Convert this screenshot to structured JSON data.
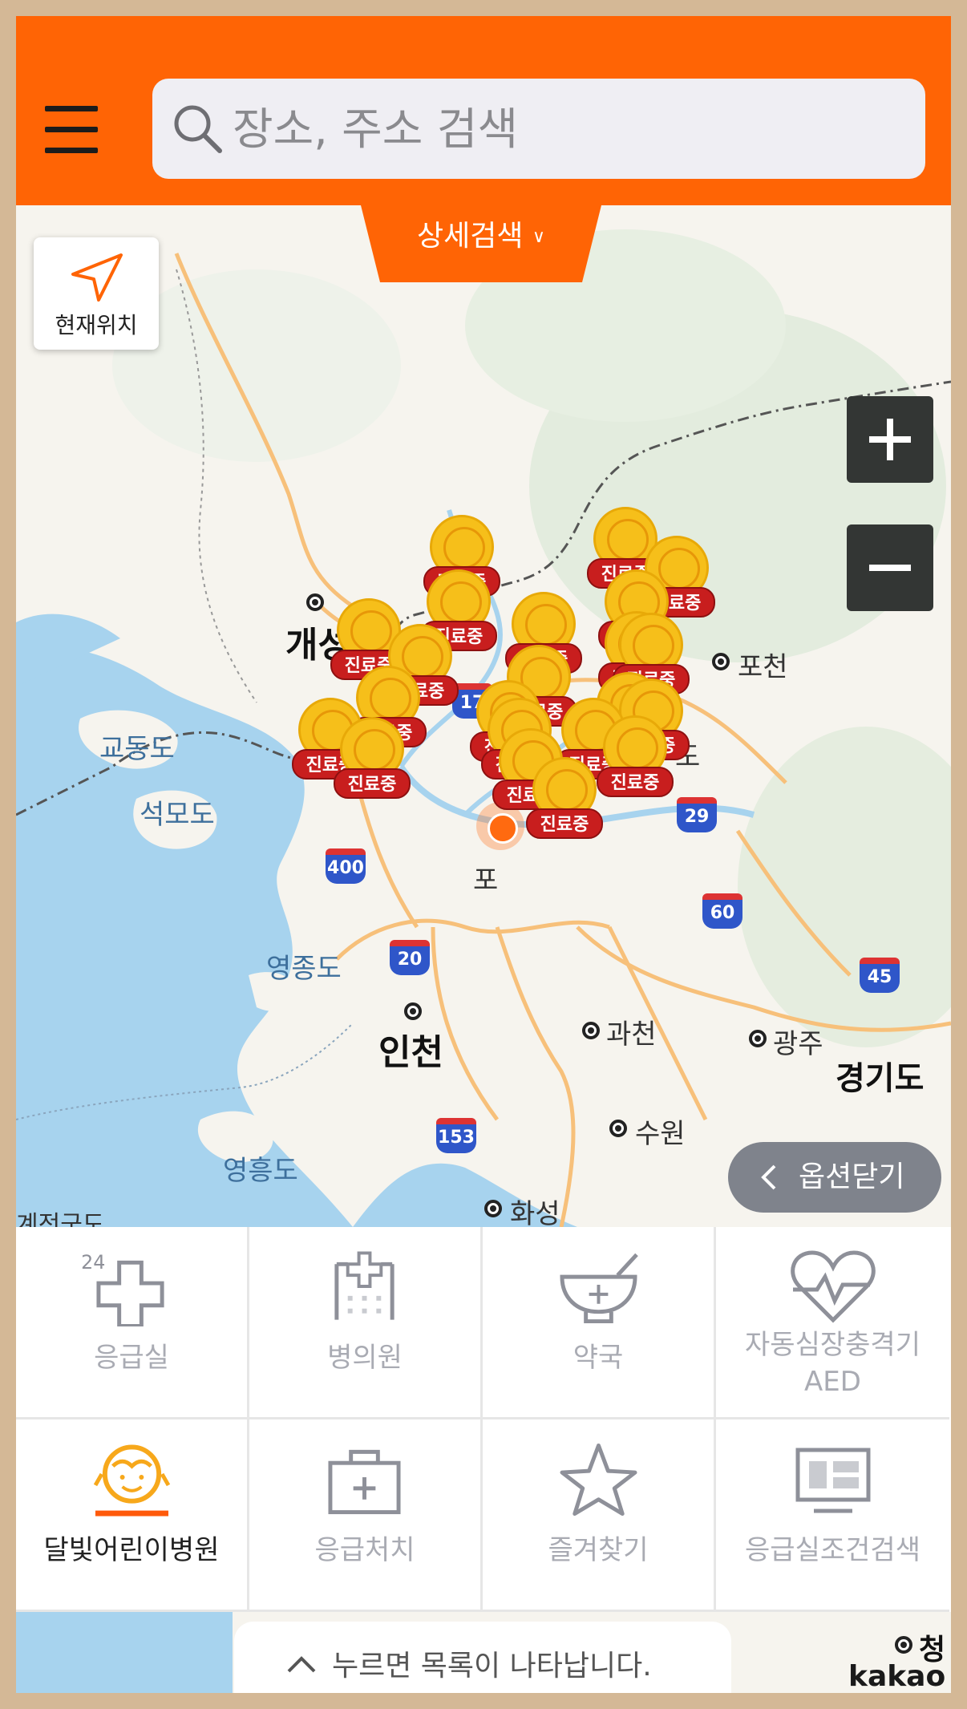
{
  "header": {
    "menu_icon": "hamburger-icon",
    "search_placeholder": "장소, 주소 검색",
    "search_icon": "search-icon"
  },
  "map": {
    "detail_search_label": "상세검색",
    "current_location_label": "현재위치",
    "zoom_in_label": "+",
    "zoom_out_label": "−",
    "options_close_label": "옵션닫기",
    "attribution": "kakao",
    "labels": {
      "kaesong": "개성",
      "pocheon": "포천",
      "gyodongdo": "교동도",
      "seokmodo": "석모도",
      "incheon": "인천",
      "gwacheon": "과천",
      "gwangju": "광주",
      "gyeonggido": "경기도",
      "suwon": "수원",
      "yeongheungdo": "영흥도",
      "hwaseong": "화성",
      "yeongjongdo_partial": "영종도",
      "cheong_partial": "청",
      "seolgu_partial": "계전군도",
      "gimpo_partial": "포",
      "paju_partial": "주",
      "jeju_partial": "도"
    },
    "route_shields": [
      "17",
      "400",
      "20",
      "29",
      "60",
      "45",
      "153"
    ],
    "marker_tag": "진료중"
  },
  "menu": {
    "items": [
      {
        "label": "응급실",
        "icon": "emergency-24-cross-icon",
        "badge": "24"
      },
      {
        "label": "병의원",
        "icon": "hospital-icon"
      },
      {
        "label": "약국",
        "icon": "pharmacy-icon"
      },
      {
        "label": "자동심장충격기\nAED",
        "icon": "heart-pulse-icon"
      },
      {
        "label": "달빛어린이병원",
        "icon": "moonlight-child-icon",
        "active": true
      },
      {
        "label": "응급처치",
        "icon": "first-aid-kit-icon"
      },
      {
        "label": "즐겨찾기",
        "icon": "star-icon"
      },
      {
        "label": "응급실조건검색",
        "icon": "monitor-icon"
      }
    ]
  },
  "list_bar": {
    "label": "누르면 목록이 나타납니다."
  },
  "colors": {
    "brand": "#ff6405",
    "marker_yellow": "#f6bf1a",
    "marker_red": "#c81e1e",
    "inactive_icon": "#8e9099"
  }
}
